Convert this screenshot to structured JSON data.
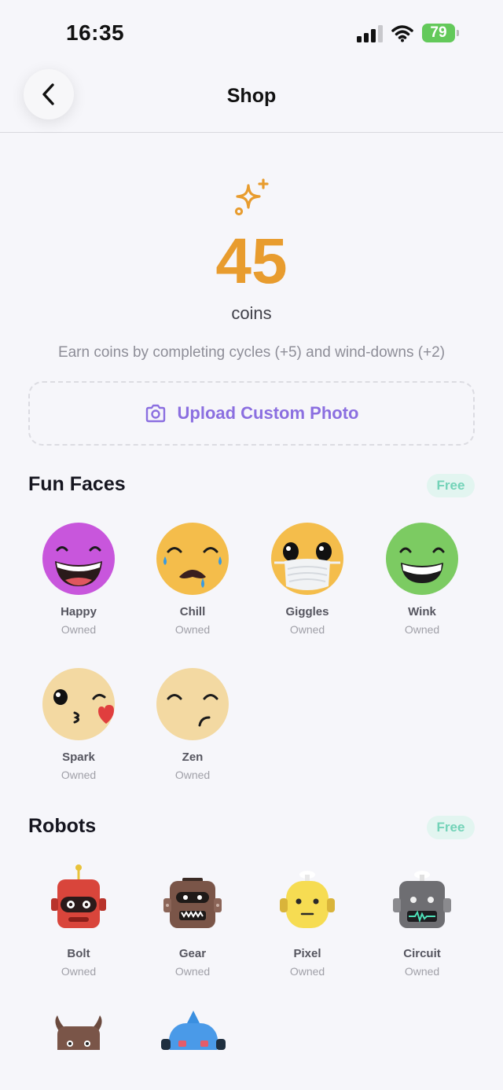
{
  "status_bar": {
    "time": "16:35",
    "battery": "79"
  },
  "nav": {
    "title": "Shop"
  },
  "coins": {
    "amount": "45",
    "unit": "coins",
    "hint": "Earn coins by completing cycles (+5) and wind-downs (+2)"
  },
  "upload": {
    "label": "Upload Custom Photo"
  },
  "sections": {
    "fun_faces": {
      "title": "Fun Faces",
      "badge": "Free",
      "items": [
        {
          "name": "Happy",
          "status": "Owned"
        },
        {
          "name": "Chill",
          "status": "Owned"
        },
        {
          "name": "Giggles",
          "status": "Owned"
        },
        {
          "name": "Wink",
          "status": "Owned"
        },
        {
          "name": "Spark",
          "status": "Owned"
        },
        {
          "name": "Zen",
          "status": "Owned"
        }
      ]
    },
    "robots": {
      "title": "Robots",
      "badge": "Free",
      "items": [
        {
          "name": "Bolt",
          "status": "Owned"
        },
        {
          "name": "Gear",
          "status": "Owned"
        },
        {
          "name": "Pixel",
          "status": "Owned"
        },
        {
          "name": "Circuit",
          "status": "Owned"
        }
      ]
    }
  },
  "colors": {
    "accent": "#E89C2E",
    "upload": "#8B6FE0",
    "badge_bg": "#E2F5F0",
    "badge_text": "#73D3B8"
  }
}
